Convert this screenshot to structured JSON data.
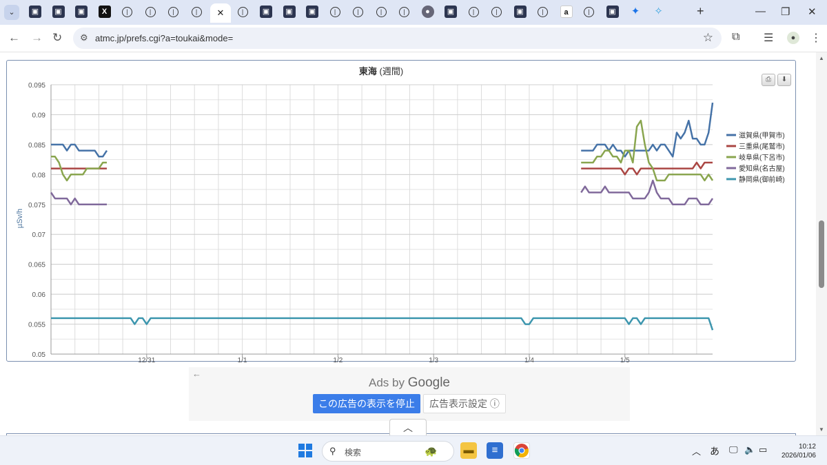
{
  "browser": {
    "tabs": [
      {
        "icon": "site-favicon-icon",
        "glyph": "▣",
        "kind": "dark"
      },
      {
        "icon": "site-favicon-icon",
        "glyph": "▣",
        "kind": "dark"
      },
      {
        "icon": "site-favicon-icon",
        "glyph": "▣",
        "kind": "dark"
      },
      {
        "icon": "x-logo-icon",
        "glyph": "X",
        "kind": "x"
      },
      {
        "icon": "circle-favicon-icon",
        "glyph": "|",
        "kind": "o"
      },
      {
        "icon": "circle-favicon-icon",
        "glyph": "|",
        "kind": "o"
      },
      {
        "icon": "circle-favicon-icon",
        "glyph": "|",
        "kind": "o"
      },
      {
        "icon": "circle-favicon-icon",
        "glyph": "|",
        "kind": "o"
      },
      {
        "icon": "close-icon",
        "glyph": "✕",
        "kind": "active"
      },
      {
        "icon": "circle-favicon-icon",
        "glyph": "|",
        "kind": "o"
      },
      {
        "icon": "site-favicon-icon",
        "glyph": "▣",
        "kind": "dark"
      },
      {
        "icon": "site-favicon-icon",
        "glyph": "▣",
        "kind": "dark"
      },
      {
        "icon": "site-favicon-icon",
        "glyph": "▣",
        "kind": "dark"
      },
      {
        "icon": "circle-favicon-icon",
        "glyph": "|",
        "kind": "o"
      },
      {
        "icon": "circle-favicon-icon",
        "glyph": "|",
        "kind": "o"
      },
      {
        "icon": "circle-favicon-icon",
        "glyph": "|",
        "kind": "o"
      },
      {
        "icon": "circle-favicon-icon",
        "glyph": "|",
        "kind": "o"
      },
      {
        "icon": "globe-icon",
        "glyph": "●",
        "kind": "globe"
      },
      {
        "icon": "site-favicon-icon",
        "glyph": "▣",
        "kind": "dark"
      },
      {
        "icon": "circle-favicon-icon",
        "glyph": "|",
        "kind": "o"
      },
      {
        "icon": "circle-favicon-icon",
        "glyph": "|",
        "kind": "o"
      },
      {
        "icon": "site-favicon-icon",
        "glyph": "▣",
        "kind": "dark"
      },
      {
        "icon": "circle-favicon-icon",
        "glyph": "|",
        "kind": "o"
      },
      {
        "icon": "amazon-icon",
        "glyph": "a",
        "kind": "a"
      },
      {
        "icon": "circle-favicon-icon",
        "glyph": "|",
        "kind": "o"
      },
      {
        "icon": "site-favicon-icon",
        "glyph": "▣",
        "kind": "dark"
      },
      {
        "icon": "butterfly-icon",
        "glyph": "✦",
        "kind": "fly"
      },
      {
        "icon": "sparkle-icon",
        "glyph": "✧",
        "kind": "sparkle"
      }
    ],
    "url": "atmc.jp/prefs.cgi?a=toukai&mode="
  },
  "chart": {
    "title_main": "東海",
    "title_sub": "(週間)",
    "ylabel": "µSv/h",
    "print_button": "⎙",
    "download_button": "⬇"
  },
  "chart_data": {
    "type": "line",
    "title": "東海 (週間)",
    "ylabel": "µSv/h",
    "ylim": [
      0.05,
      0.095
    ],
    "yticks": [
      "0.05",
      "0.055",
      "0.06",
      "0.065",
      "0.07",
      "0.075",
      "0.08",
      "0.085",
      "0.09",
      "0.095"
    ],
    "xticks": [
      "12/31",
      "1/1",
      "1/2",
      "1/3",
      "1/4",
      "1/5"
    ],
    "x_range_hours": [
      0,
      166
    ],
    "xtick_hours": [
      24,
      48,
      72,
      96,
      120,
      144
    ],
    "grid": true,
    "legend_position": "right",
    "series": [
      {
        "name": "滋賀県(甲賀市)",
        "color": "#4572a7",
        "x": [
          0,
          1,
          2,
          3,
          4,
          5,
          6,
          7,
          8,
          9,
          10,
          11,
          12,
          13,
          14,
          null,
          133,
          134,
          135,
          136,
          137,
          138,
          139,
          140,
          141,
          142,
          143,
          144,
          145,
          146,
          147,
          148,
          149,
          150,
          151,
          152,
          153,
          154,
          155,
          156,
          157,
          158,
          159,
          160,
          161,
          162,
          163,
          164,
          165,
          166
        ],
        "y": [
          0.085,
          0.085,
          0.085,
          0.085,
          0.084,
          0.085,
          0.085,
          0.084,
          0.084,
          0.084,
          0.084,
          0.084,
          0.083,
          0.083,
          0.084,
          null,
          0.084,
          0.084,
          0.084,
          0.084,
          0.085,
          0.085,
          0.085,
          0.084,
          0.085,
          0.084,
          0.084,
          0.083,
          0.084,
          0.084,
          0.084,
          0.084,
          0.084,
          0.084,
          0.085,
          0.084,
          0.085,
          0.085,
          0.084,
          0.083,
          0.087,
          0.086,
          0.087,
          0.089,
          0.086,
          0.086,
          0.085,
          0.085,
          0.087,
          0.092
        ]
      },
      {
        "name": "三重県(尾鷲市)",
        "color": "#aa4643",
        "x": [
          0,
          14,
          null,
          133,
          141,
          142,
          143,
          144,
          145,
          146,
          147,
          148,
          149,
          150,
          151,
          152,
          153,
          154,
          155,
          156,
          157,
          158,
          159,
          160,
          161,
          162,
          163,
          164,
          165,
          166
        ],
        "y": [
          0.081,
          0.081,
          null,
          0.081,
          0.081,
          0.081,
          0.081,
          0.08,
          0.081,
          0.081,
          0.08,
          0.081,
          0.081,
          0.081,
          0.081,
          0.081,
          0.081,
          0.081,
          0.081,
          0.081,
          0.081,
          0.081,
          0.081,
          0.081,
          0.081,
          0.082,
          0.081,
          0.082,
          0.082,
          0.082
        ]
      },
      {
        "name": "岐阜県(下呂市)",
        "color": "#89a54e",
        "x": [
          0,
          1,
          2,
          3,
          4,
          5,
          6,
          7,
          8,
          9,
          10,
          11,
          12,
          13,
          14,
          null,
          133,
          134,
          135,
          136,
          137,
          138,
          139,
          140,
          141,
          142,
          143,
          144,
          145,
          146,
          147,
          148,
          149,
          150,
          151,
          152,
          153,
          154,
          155,
          156,
          157,
          158,
          159,
          160,
          161,
          162,
          163,
          164,
          165,
          166
        ],
        "y": [
          0.083,
          0.083,
          0.082,
          0.08,
          0.079,
          0.08,
          0.08,
          0.08,
          0.08,
          0.081,
          0.081,
          0.081,
          0.081,
          0.082,
          0.082,
          null,
          0.082,
          0.082,
          0.082,
          0.082,
          0.083,
          0.083,
          0.084,
          0.084,
          0.083,
          0.083,
          0.082,
          0.084,
          0.084,
          0.082,
          0.088,
          0.089,
          0.085,
          0.082,
          0.081,
          0.079,
          0.079,
          0.079,
          0.08,
          0.08,
          0.08,
          0.08,
          0.08,
          0.08,
          0.08,
          0.08,
          0.08,
          0.079,
          0.08,
          0.079
        ]
      },
      {
        "name": "愛知県(名古屋)",
        "color": "#80699b",
        "x": [
          0,
          1,
          2,
          3,
          4,
          5,
          6,
          7,
          8,
          9,
          10,
          11,
          12,
          13,
          14,
          null,
          133,
          134,
          135,
          136,
          137,
          138,
          139,
          140,
          141,
          142,
          143,
          144,
          145,
          146,
          147,
          148,
          149,
          150,
          151,
          152,
          153,
          154,
          155,
          156,
          157,
          158,
          159,
          160,
          161,
          162,
          163,
          164,
          165,
          166
        ],
        "y": [
          0.077,
          0.076,
          0.076,
          0.076,
          0.076,
          0.075,
          0.076,
          0.075,
          0.075,
          0.075,
          0.075,
          0.075,
          0.075,
          0.075,
          0.075,
          null,
          0.077,
          0.078,
          0.077,
          0.077,
          0.077,
          0.077,
          0.078,
          0.077,
          0.077,
          0.077,
          0.077,
          0.077,
          0.077,
          0.076,
          0.076,
          0.076,
          0.076,
          0.077,
          0.079,
          0.077,
          0.076,
          0.076,
          0.076,
          0.075,
          0.075,
          0.075,
          0.075,
          0.076,
          0.076,
          0.076,
          0.075,
          0.075,
          0.075,
          0.076
        ]
      },
      {
        "name": "静岡県(御前崎)",
        "color": "#3d96ae",
        "x": [
          0,
          20,
          21,
          22,
          23,
          24,
          25,
          26,
          118,
          119,
          120,
          121,
          122,
          144,
          145,
          146,
          147,
          148,
          149,
          150,
          165,
          166
        ],
        "y": [
          0.056,
          0.056,
          0.055,
          0.056,
          0.056,
          0.055,
          0.056,
          0.056,
          0.056,
          0.055,
          0.055,
          0.056,
          0.056,
          0.056,
          0.055,
          0.056,
          0.056,
          0.055,
          0.056,
          0.056,
          0.056,
          0.054
        ]
      }
    ]
  },
  "ads": {
    "back_arrow": "←",
    "ads_by": "Ads by",
    "google": "Google",
    "stop_button": "この広告の表示を停止",
    "settings_button": "広告表示設定 ⓘ"
  },
  "page": {
    "collapse_glyph": "︿"
  },
  "taskbar": {
    "search_label": "検索",
    "time": "10:12",
    "date": "2026/01/06",
    "ime": "あ"
  },
  "colors": {
    "tab_strip": "#dfe6f5",
    "ad_stop": "#3b7de9"
  }
}
